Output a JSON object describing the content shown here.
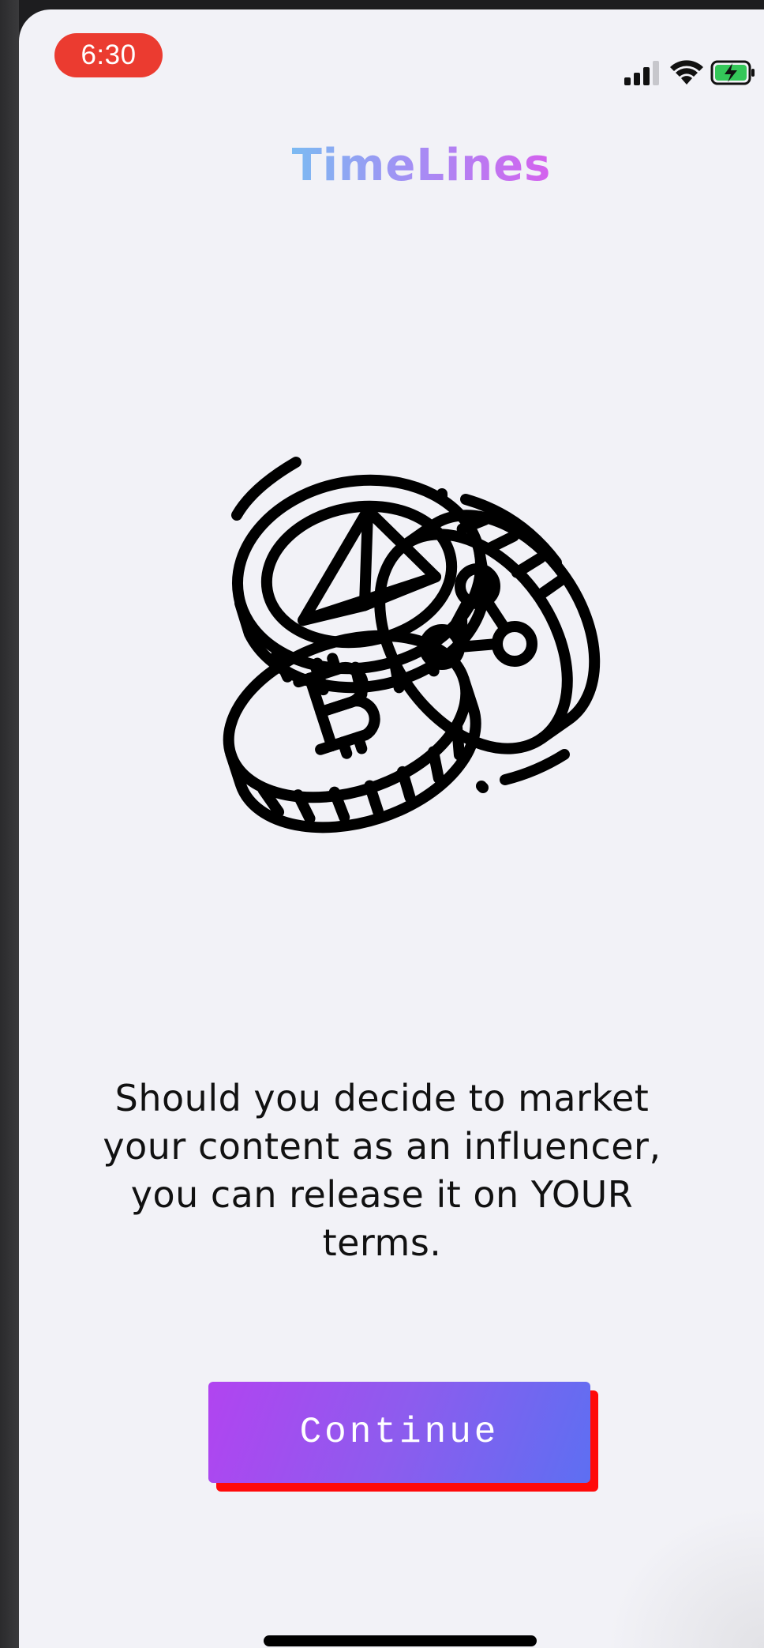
{
  "status_bar": {
    "time": "6:30",
    "time_pill_color": "#eb3b30",
    "icons": [
      "signal-icon",
      "wifi-icon",
      "battery-charging-icon"
    ]
  },
  "header": {
    "title": "TimeLines",
    "title_gradient": [
      "#7cbaf2",
      "#a78bf4",
      "#d561ee"
    ]
  },
  "illustration": {
    "icon": "crypto-coins-icon"
  },
  "main": {
    "description": "Should you decide to market your content as an influencer, you can release it on YOUR terms."
  },
  "actions": {
    "continue_label": "Continue",
    "continue_gradient": [
      "#b144f0",
      "#5d6ff2"
    ],
    "continue_shadow_color": "#ff0a0a"
  }
}
